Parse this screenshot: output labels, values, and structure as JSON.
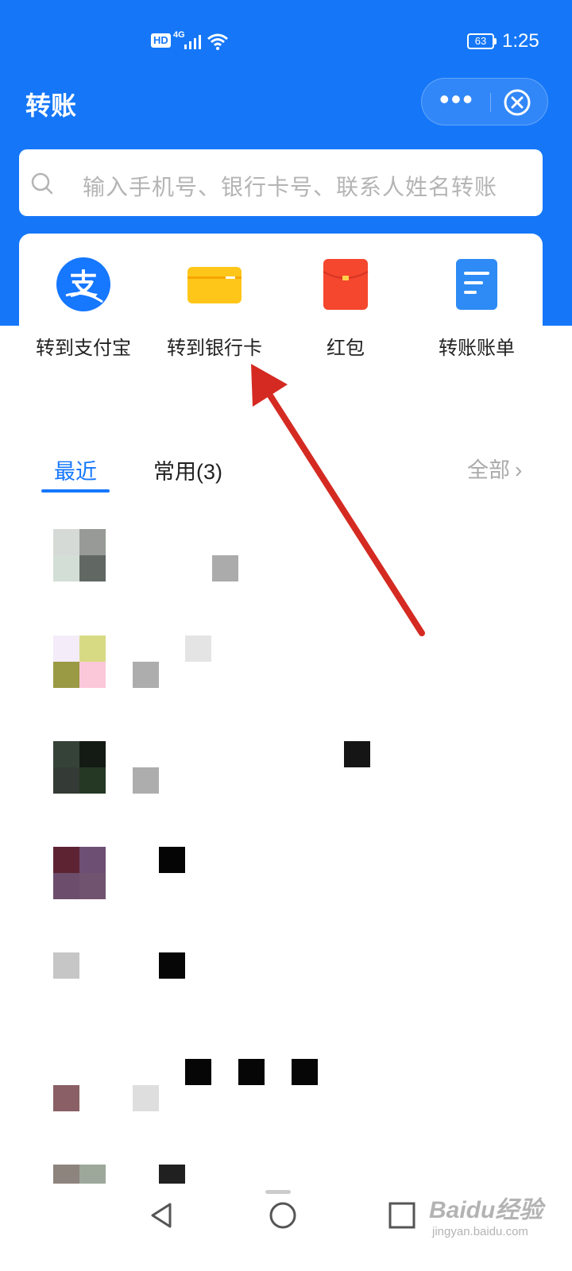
{
  "status_bar": {
    "hd": "HD",
    "network": "4G",
    "battery": "63",
    "time": "1:25"
  },
  "header": {
    "title": "转账",
    "capsule": {
      "more_icon": "more-dots-icon",
      "close_icon": "close-circle-icon"
    }
  },
  "search": {
    "placeholder": "输入手机号、银行卡号、联系人姓名转账",
    "icon": "search-icon"
  },
  "actions": [
    {
      "label": "转到支付宝",
      "icon": "alipay-logo-icon",
      "color": "#1677FF"
    },
    {
      "label": "转到银行卡",
      "icon": "bank-card-icon",
      "color": "#FFC61A"
    },
    {
      "label": "红包",
      "icon": "red-envelope-icon",
      "color": "#F5462E"
    },
    {
      "label": "转账账单",
      "icon": "bill-document-icon",
      "color": "#2E8BF5"
    }
  ],
  "tabs": {
    "recent": "最近",
    "common": "常用(3)",
    "view_all": "全部"
  },
  "contacts_count_shown": 7,
  "nav_bar": {
    "back_icon": "back-triangle-icon",
    "home_icon": "home-circle-icon",
    "recents_icon": "recents-square-icon"
  },
  "watermark": {
    "mark": "Baidu经验",
    "sub": "jingyan.baidu.com"
  },
  "colors": {
    "brand_blue": "#1577F8",
    "annotation_arrow": "#D42A22"
  }
}
